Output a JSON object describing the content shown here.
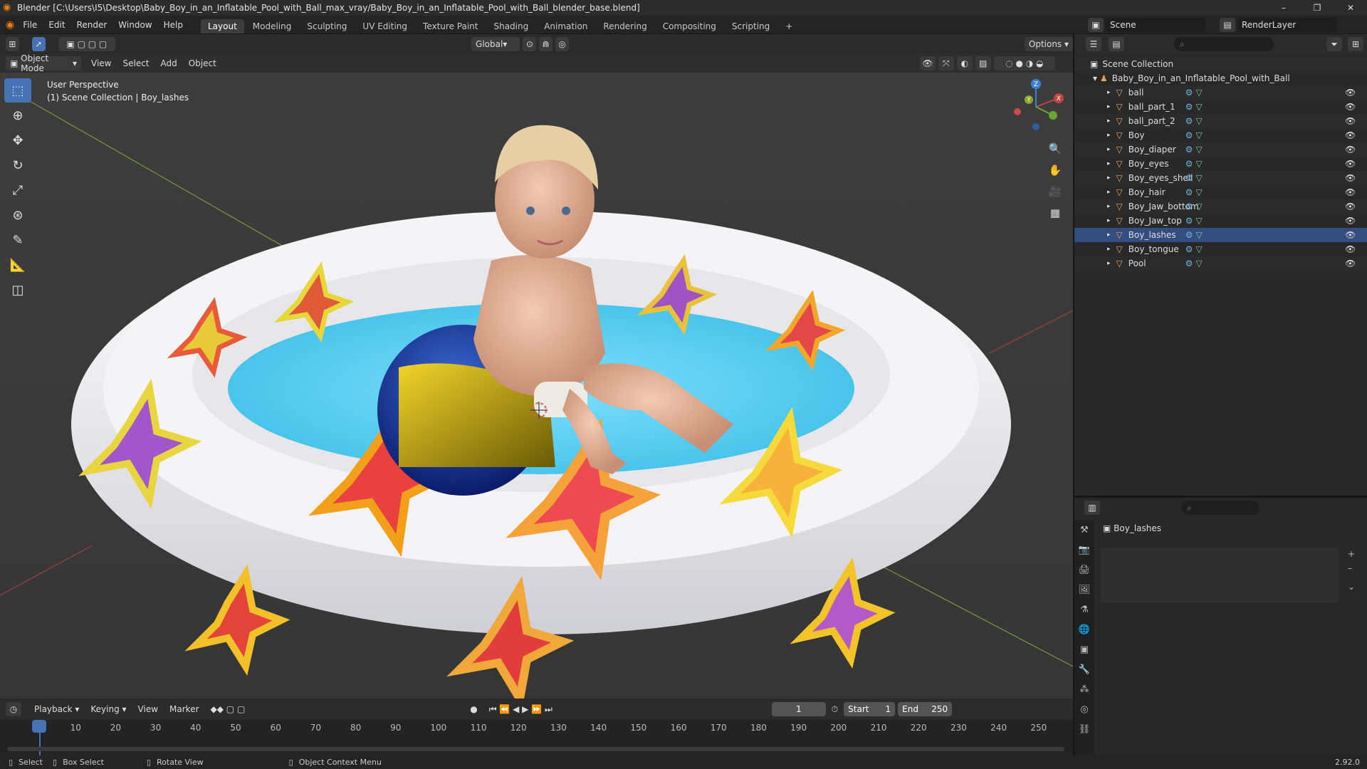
{
  "window": {
    "title": "Blender [C:\\Users\\I5\\Desktop\\Baby_Boy_in_an_Inflatable_Pool_with_Ball_max_vray/Baby_Boy_in_an_Inflatable_Pool_with_Ball_blender_base.blend]",
    "minimize": "–",
    "maximize": "❐",
    "close": "✕"
  },
  "menu": {
    "file": "File",
    "edit": "Edit",
    "render": "Render",
    "window": "Window",
    "help": "Help"
  },
  "workspaces": [
    "Layout",
    "Modeling",
    "Sculpting",
    "UV Editing",
    "Texture Paint",
    "Shading",
    "Animation",
    "Rendering",
    "Compositing",
    "Scripting"
  ],
  "scene": {
    "label": "Scene",
    "render_layer": "RenderLayer"
  },
  "toolheader": {
    "orientation": "Global",
    "options": "Options"
  },
  "viewheader": {
    "mode": "Object Mode",
    "view": "View",
    "select": "Select",
    "add": "Add",
    "object": "Object"
  },
  "viewport": {
    "perspective": "User Perspective",
    "collection_info": "(1) Scene Collection | Boy_lashes"
  },
  "gizmo": {
    "x": "X",
    "y": "Y",
    "z": "Z"
  },
  "outliner": {
    "root": "Scene Collection",
    "collection": "Baby_Boy_in_an_Inflatable_Pool_with_Ball",
    "items": [
      "ball",
      "ball_part_1",
      "ball_part_2",
      "Boy",
      "Boy_diaper",
      "Boy_eyes",
      "Boy_eyes_shell",
      "Boy_hair",
      "Boy_Jaw_bottom",
      "Boy_Jaw_top",
      "Boy_lashes",
      "Boy_tongue",
      "Pool"
    ]
  },
  "properties": {
    "object_name": "Boy_lashes"
  },
  "timeline": {
    "playback": "Playback",
    "keying": "Keying",
    "view": "View",
    "marker": "Marker",
    "current_frame": "1",
    "start_label": "Start",
    "start": "1",
    "end_label": "End",
    "end": "250",
    "ticks": [
      "1",
      "10",
      "20",
      "30",
      "40",
      "50",
      "60",
      "70",
      "80",
      "90",
      "100",
      "110",
      "120",
      "130",
      "140",
      "150",
      "160",
      "170",
      "180",
      "190",
      "200",
      "210",
      "220",
      "230",
      "240",
      "250"
    ]
  },
  "status": {
    "select": "Select",
    "box_select": "Box Select",
    "rotate": "Rotate View",
    "context": "Object Context Menu",
    "version": "2.92.0"
  }
}
